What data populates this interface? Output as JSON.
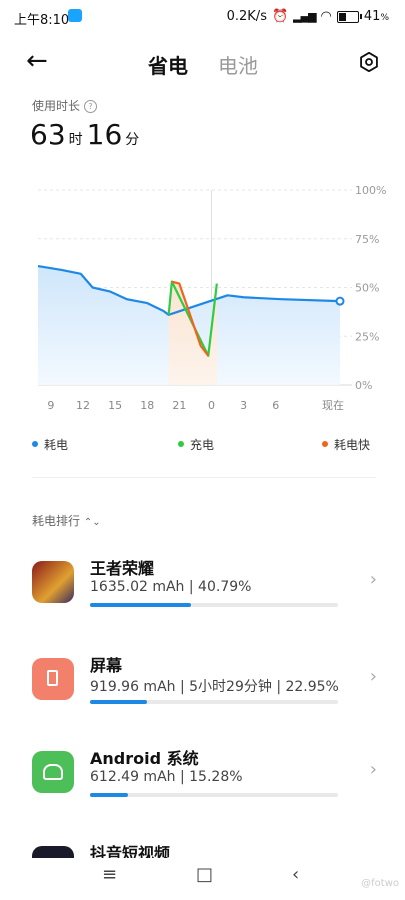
{
  "status": {
    "time": "上午8:10",
    "speed": "0.2K/s",
    "battery": "41",
    "battery_unit": "%",
    "battery_level": 0.41
  },
  "header": {
    "back_icon": "arrow-left-icon",
    "tab_active": "省电",
    "tab_other": "电池",
    "settings_icon": "gear-icon"
  },
  "usage": {
    "label": "使用时长",
    "hours": "63",
    "hours_unit": "时",
    "minutes": "16",
    "minutes_unit": "分"
  },
  "chart_data": {
    "type": "line",
    "x_ticks": [
      "9",
      "12",
      "15",
      "18",
      "21",
      "0",
      "3",
      "6",
      "现在"
    ],
    "y_ticks": [
      "100%",
      "75%",
      "50%",
      "25%",
      "0%"
    ],
    "ylim": [
      0,
      100
    ],
    "series": [
      {
        "name": "耗电",
        "color": "#1e88e5",
        "points": [
          [
            7.8,
            61
          ],
          [
            10,
            59
          ],
          [
            11.8,
            57
          ],
          [
            12.9,
            50
          ],
          [
            14.5,
            48
          ],
          [
            16.1,
            44
          ],
          [
            18,
            42
          ],
          [
            19.5,
            38
          ],
          [
            20,
            36
          ],
          [
            25.5,
            46
          ],
          [
            27,
            45
          ],
          [
            30.5,
            44
          ],
          [
            36,
            43
          ]
        ]
      },
      {
        "name": "充电",
        "color": "#2ecc40",
        "points": [
          [
            20,
            36
          ],
          [
            20.3,
            53
          ],
          [
            23.7,
            15
          ],
          [
            24.5,
            52
          ]
        ]
      },
      {
        "name": "耗电快",
        "color": "#f0641e",
        "points": [
          [
            20.3,
            53
          ],
          [
            21,
            52
          ],
          [
            23,
            20
          ],
          [
            23.7,
            15
          ]
        ]
      }
    ]
  },
  "legend": {
    "drain": "耗电",
    "charge": "充电",
    "fast": "耗电快",
    "drain_color": "#1e88e5",
    "charge_color": "#2ecc40",
    "fast_color": "#f0641e"
  },
  "ranking": {
    "label": "耗电排行"
  },
  "apps": [
    {
      "name": "王者荣耀",
      "stats": "1635.02 mAh | 40.79%",
      "percent": 40.79
    },
    {
      "name": "屏幕",
      "stats": "919.96 mAh | 5小时29分钟 | 22.95%",
      "percent": 22.95
    },
    {
      "name": "Android 系统",
      "stats": "612.49 mAh | 15.28%",
      "percent": 15.28
    },
    {
      "name": "抖音短视频",
      "stats": "",
      "percent": 0
    }
  ],
  "nav": {
    "menu_icon": "≡",
    "home_icon": "□",
    "back_icon": "‹"
  },
  "watermark": "@fotwo"
}
